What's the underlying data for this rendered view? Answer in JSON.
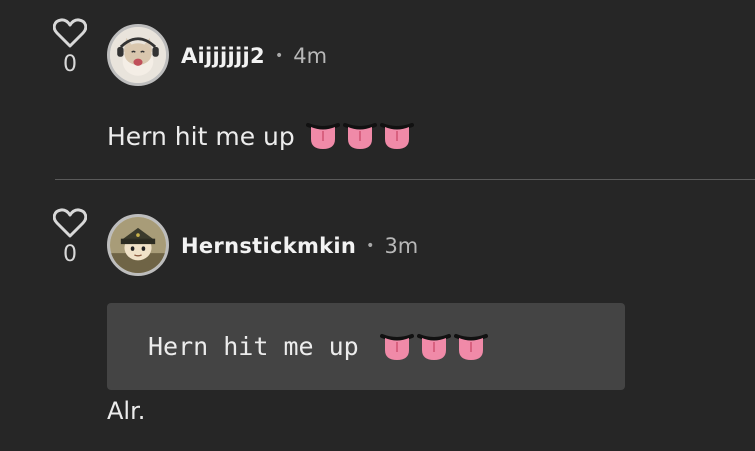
{
  "comments": [
    {
      "like_count": "0",
      "username": "Aijjjjjj2",
      "separator": "•",
      "time": "4m",
      "text": "Hern hit me up",
      "emoji": [
        "tongue-emoji",
        "tongue-emoji",
        "tongue-emoji"
      ]
    },
    {
      "like_count": "0",
      "username": "Hernstickmkin",
      "separator": "•",
      "time": "3m",
      "quote": "Hern hit me up",
      "quote_emoji": [
        "tongue-emoji",
        "tongue-emoji",
        "tongue-emoji"
      ],
      "text": "Alr."
    }
  ],
  "colors": {
    "background": "#262626",
    "quote_block": "#444444",
    "divider": "#5a5a5a",
    "tongue": "#f08aa8"
  }
}
